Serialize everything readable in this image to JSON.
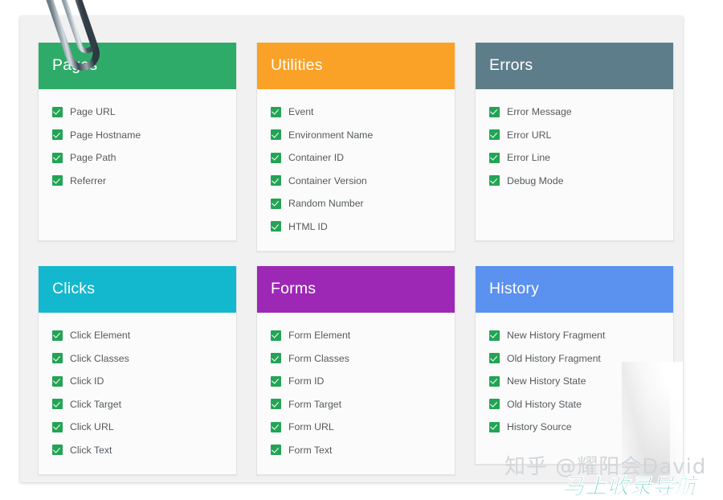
{
  "watermarks": {
    "zhihu": "知乎 @耀阳会David",
    "nav": "马上收录导航"
  },
  "icons": {
    "paperclip": "paperclip-icon",
    "check": "check-icon"
  },
  "colors": {
    "pages": "#2fab69",
    "utilities": "#f9a227",
    "errors": "#5e7d8b",
    "clicks": "#14b8ce",
    "forms": "#9d28b5",
    "history": "#5b91ef",
    "checkbox": "#23a455",
    "page_background": "#f1f1f1",
    "card_body": "#fbfbfb",
    "label_text": "#555a5e"
  },
  "cards": [
    {
      "id": "pages",
      "title": "Pages",
      "color": "#2fab69",
      "items": [
        {
          "label": "Page URL",
          "checked": true
        },
        {
          "label": "Page Hostname",
          "checked": true
        },
        {
          "label": "Page Path",
          "checked": true
        },
        {
          "label": "Referrer",
          "checked": true
        }
      ]
    },
    {
      "id": "utilities",
      "title": "Utilities",
      "color": "#f9a227",
      "items": [
        {
          "label": "Event",
          "checked": true
        },
        {
          "label": "Environment Name",
          "checked": true
        },
        {
          "label": "Container ID",
          "checked": true
        },
        {
          "label": "Container Version",
          "checked": true
        },
        {
          "label": "Random Number",
          "checked": true
        },
        {
          "label": "HTML ID",
          "checked": true
        }
      ]
    },
    {
      "id": "errors",
      "title": "Errors",
      "color": "#5e7d8b",
      "items": [
        {
          "label": "Error Message",
          "checked": true
        },
        {
          "label": "Error URL",
          "checked": true
        },
        {
          "label": "Error Line",
          "checked": true
        },
        {
          "label": "Debug Mode",
          "checked": true
        }
      ]
    },
    {
      "id": "clicks",
      "title": "Clicks",
      "color": "#14b8ce",
      "items": [
        {
          "label": "Click Element",
          "checked": true
        },
        {
          "label": "Click Classes",
          "checked": true
        },
        {
          "label": "Click ID",
          "checked": true
        },
        {
          "label": "Click Target",
          "checked": true
        },
        {
          "label": "Click URL",
          "checked": true
        },
        {
          "label": "Click Text",
          "checked": true
        }
      ]
    },
    {
      "id": "forms",
      "title": "Forms",
      "color": "#9d28b5",
      "items": [
        {
          "label": "Form Element",
          "checked": true
        },
        {
          "label": "Form Classes",
          "checked": true
        },
        {
          "label": "Form ID",
          "checked": true
        },
        {
          "label": "Form Target",
          "checked": true
        },
        {
          "label": "Form URL",
          "checked": true
        },
        {
          "label": "Form Text",
          "checked": true
        }
      ]
    },
    {
      "id": "history",
      "title": "History",
      "color": "#5b91ef",
      "items": [
        {
          "label": "New History Fragment",
          "checked": true
        },
        {
          "label": "Old History Fragment",
          "checked": true
        },
        {
          "label": "New History State",
          "checked": true
        },
        {
          "label": "Old History State",
          "checked": true
        },
        {
          "label": "History Source",
          "checked": true
        }
      ]
    }
  ]
}
